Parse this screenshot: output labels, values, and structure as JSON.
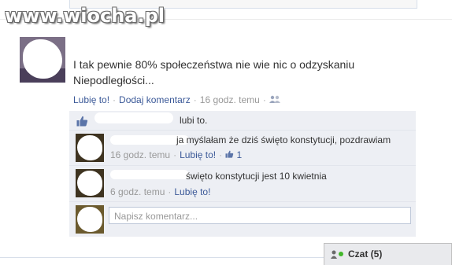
{
  "watermark": "www.wiocha.pl",
  "post": {
    "text_line1": "I tak pewnie 80% społeczeństwa nie wie nic o odzyskaniu",
    "text_line2": "Niepodległości...",
    "like_label": "Lubię to!",
    "comment_label": "Dodaj komentarz",
    "time": "16 godz. temu"
  },
  "likes": {
    "text": "lubi to."
  },
  "comments": [
    {
      "text": "ja myślałam że dziś święto konstytucji, pozdrawiam",
      "time": "16 godz. temu",
      "like_label": "Lubię to!",
      "like_count": "1"
    },
    {
      "text": "święto konstytucji jest 10 kwietnia",
      "time": "6 godz. temu",
      "like_label": "Lubię to!"
    }
  ],
  "comment_input": {
    "placeholder": "Napisz komentarz..."
  },
  "chat": {
    "label": "Czat (5)"
  },
  "colors": {
    "link": "#3b5998",
    "feedback_bg": "#edeff4",
    "online": "#42b72a"
  },
  "icons": [
    "thumbs-up-icon",
    "friends-icon",
    "chat-user-icon",
    "online-dot-icon"
  ]
}
